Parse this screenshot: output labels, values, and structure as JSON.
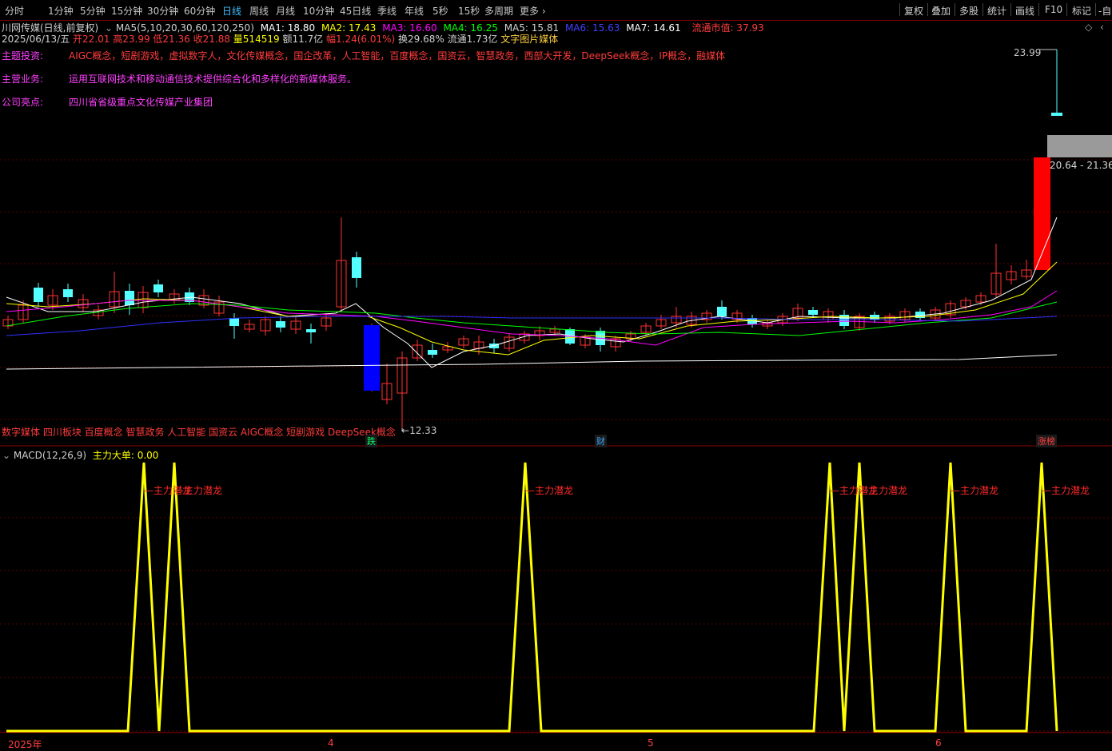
{
  "toolbar": {
    "periods": [
      "分时",
      "1分钟",
      "5分钟",
      "15分钟",
      "30分钟",
      "60分钟",
      "日线",
      "周线",
      "月线",
      "10分钟",
      "45日线",
      "季线",
      "年线",
      "5秒",
      "15秒",
      "多周期",
      "更多"
    ],
    "active_period": "日线",
    "right_buttons": [
      "复权",
      "叠加",
      "多股",
      "统计",
      "画线",
      "F10",
      "标记",
      "-自"
    ]
  },
  "header": {
    "stock": "川网传媒(日线,前复权)",
    "ma_params": "MA5(5,10,20,30,60,120,250)",
    "ma1": "MA1: 18.80",
    "ma2": "MA2: 17.43",
    "ma3": "MA3: 16.60",
    "ma4": "MA4: 16.25",
    "ma5": "MA5: 15.81",
    "ma6": "MA6: 15.63",
    "ma7": "MA7: 14.61",
    "float_cap": "流通市值: 37.93"
  },
  "quote": {
    "date": "2025/06/13/五",
    "open": "开22.01",
    "high": "高23.99",
    "low": "低21.36",
    "close": "收21.88",
    "volume": "量514519",
    "amount": "额11.7亿",
    "change": "幅1.24(6.01%)",
    "turnover": "换29.68%",
    "float_shares": "流通1.73亿",
    "sector": "文字图片媒体"
  },
  "info": {
    "theme_label": "主题投资:",
    "theme_value": "AIGC概念，短剧游戏，虚拟数字人，文化传媒概念，国企改革，人工智能，百度概念，国资云，智慧政务，西部大开发，DeepSeek概念，IP概念，融媒体",
    "business_label": "主营业务:",
    "business_value": "运用互联网技术和移动通信技术提供综合化和多样化的新媒体服务。",
    "highlight_label": "公司亮点:",
    "highlight_value": "四川省省级重点文化传媒产业集团"
  },
  "price_labels": {
    "high_marker": "23.99",
    "low_marker": "12.33",
    "range_box": "20.64 - 21.36"
  },
  "concept_bar": "数字媒体 四川板块 百度概念 智慧政务 人工智能 国资云 AIGC概念 短剧游戏 DeepSeek概念",
  "event_marks": {
    "down": "跌",
    "fin": "财",
    "limit_up": "涨榜"
  },
  "indicator": {
    "name": "MACD(12,26,9)",
    "value": "主力大单: 0.00",
    "signal_label": "主力潜龙",
    "color": "#ffff00"
  },
  "chart_data": {
    "type": "line",
    "series": [
      {
        "name": "主力大单",
        "values": [
          0,
          1,
          0,
          1,
          0,
          1,
          0,
          1,
          0,
          1,
          0,
          1,
          0,
          1,
          0
        ]
      }
    ],
    "ylim": [
      0,
      1
    ]
  },
  "x_axis": {
    "labels": [
      "2025年",
      "4",
      "5",
      "6"
    ]
  },
  "colors": {
    "up": "#ff3232",
    "down": "#54ffff",
    "big_down": "#0000ff",
    "big_up": "#ff0000",
    "ma_white": "#ffffff",
    "ma_yellow": "#ffff00",
    "ma_magenta": "#ff00ff",
    "ma_green": "#00ff00",
    "ma_blue": "#3030ff",
    "grid": "#5a0000"
  }
}
